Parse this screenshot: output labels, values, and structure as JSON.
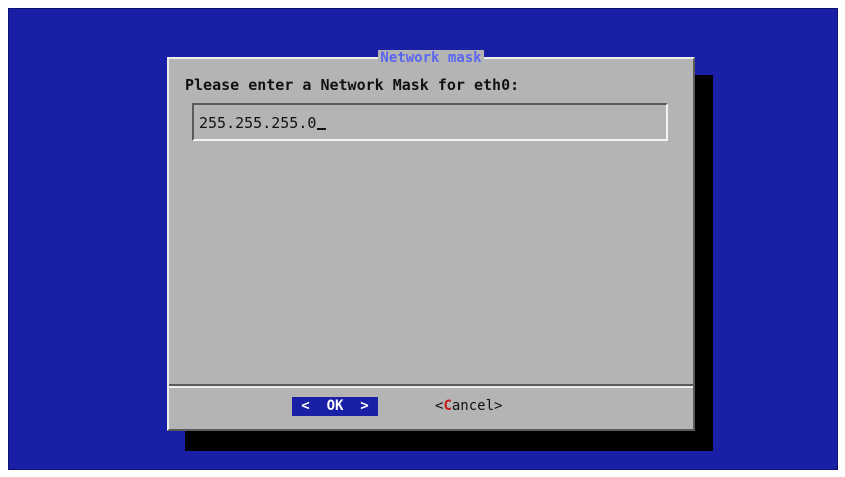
{
  "dialog": {
    "title": "Network mask",
    "prompt": "Please enter a Network Mask for eth0:",
    "input_value": "255.255.255.0"
  },
  "buttons": {
    "ok": {
      "left": "<",
      "label": "OK",
      "right": ">"
    },
    "cancel": {
      "left": "<",
      "hotkey": "C",
      "rest": "ancel",
      "right": ">"
    }
  },
  "colors": {
    "background": "#1a20a6",
    "dialog": "#b4b4b4",
    "title": "#5a66f0",
    "hotkey": "#c81a1a",
    "shadow": "#000000"
  }
}
